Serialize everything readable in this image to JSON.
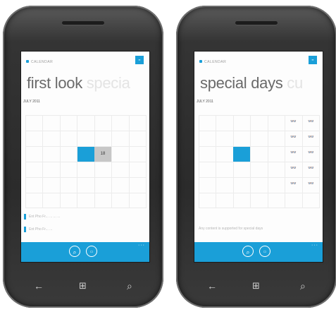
{
  "left": {
    "app_title": "CALENDAR",
    "pivot_active": "first look",
    "pivot_next": "specia",
    "month": "JULY 2011",
    "grey_cell_text": "18",
    "appointments": [
      "Ent Pho Fr... ... ... ...",
      "Ent Pho Fr... ..."
    ],
    "appbar_icons": [
      "search-icon",
      "today-icon"
    ]
  },
  "right": {
    "app_title": "CALENDAR",
    "pivot_active": "special days",
    "pivot_next": "cu",
    "month": "JULY 2011",
    "glasses_symbol": "👓",
    "note": "Any content is supported for special days",
    "appbar_icons": [
      "search-icon",
      "today-icon"
    ]
  },
  "hardware": {
    "back": "←",
    "start": "⊞",
    "search": "⌕"
  },
  "colors": {
    "accent": "#1a9fd8",
    "glasses": "#e9731c",
    "grey_cell": "#c7c7c7"
  }
}
